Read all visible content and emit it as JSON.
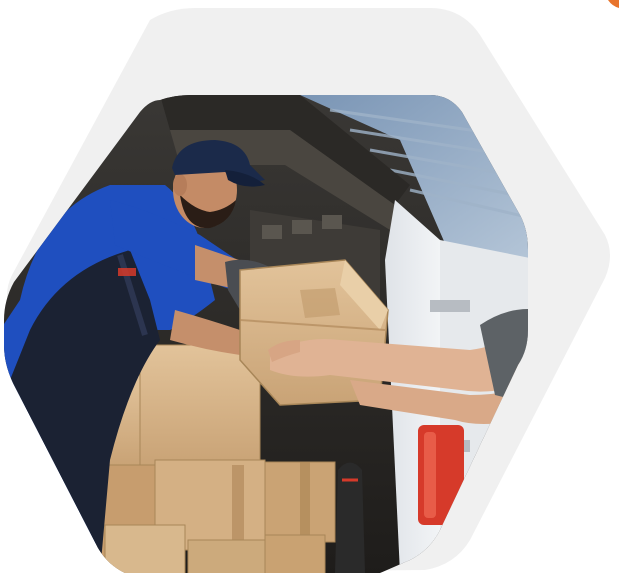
{
  "image": {
    "subject": "delivery-worker-handing-cardboard-box-from-van",
    "colors": {
      "background": "#ffffff",
      "outer_hexagon": "#f0f0f0",
      "accent_corner": "#e8742c",
      "uniform_blue": "#1f4fbf",
      "cap_navy": "#1b2a4a",
      "cardboard": "#d9b88c",
      "tail_light": "#d63a2a"
    }
  }
}
